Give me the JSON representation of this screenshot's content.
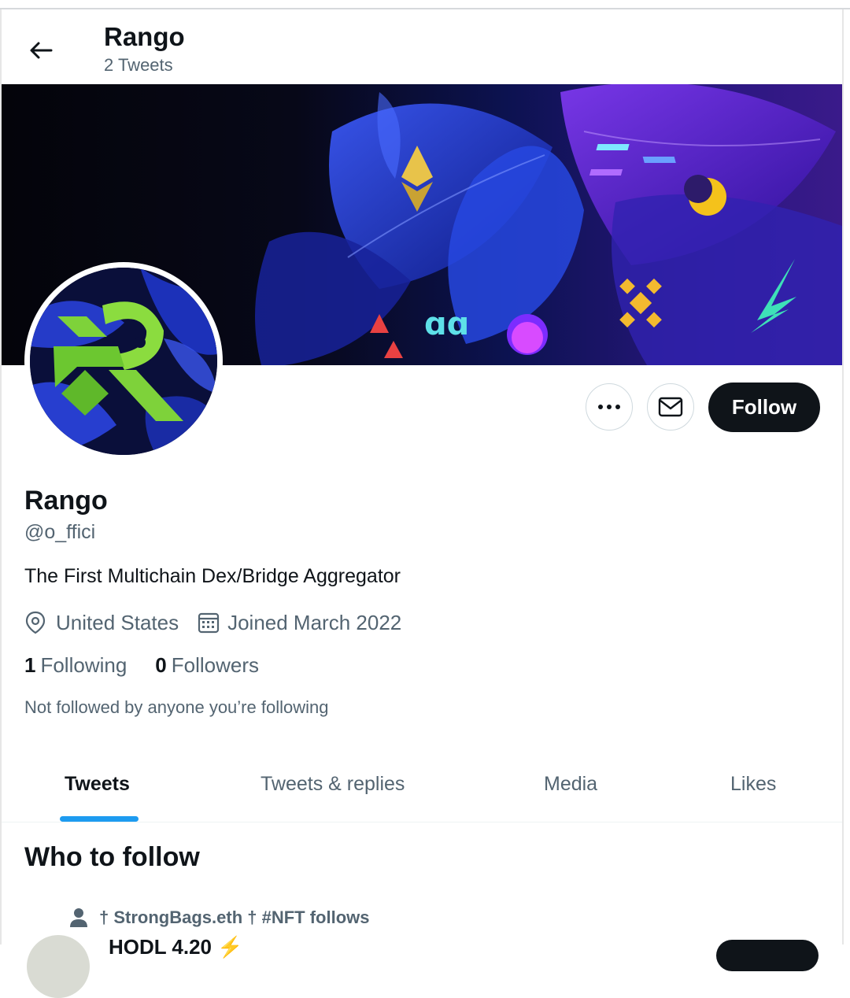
{
  "header": {
    "title": "Rango",
    "subtitle": "2 Tweets"
  },
  "profile": {
    "name": "Rango",
    "handle": "@o_ffici",
    "bio": "The First Multichain Dex/Bridge Aggregator",
    "location": "United States",
    "joined": "Joined March 2022",
    "following_count": "1",
    "following_label": "Following",
    "followers_count": "0",
    "followers_label": "Followers",
    "not_followed": "Not followed by anyone you’re following"
  },
  "actions": {
    "follow_label": "Follow",
    "more_icon": "more-icon",
    "message_icon": "envelope-icon"
  },
  "tabs": [
    {
      "label": "Tweets",
      "active": true
    },
    {
      "label": "Tweets & replies",
      "active": false
    },
    {
      "label": "Media",
      "active": false
    },
    {
      "label": "Likes",
      "active": false
    }
  ],
  "who_to_follow": {
    "title": "Who to follow",
    "social_context": "† StrongBags.eth † #NFT follows",
    "partial_name": "HODL 4.20 ⚡"
  },
  "colors": {
    "accent": "#1d9bf0",
    "text": "#0f1419",
    "secondary": "#536471",
    "button_dark": "#0f1419"
  }
}
